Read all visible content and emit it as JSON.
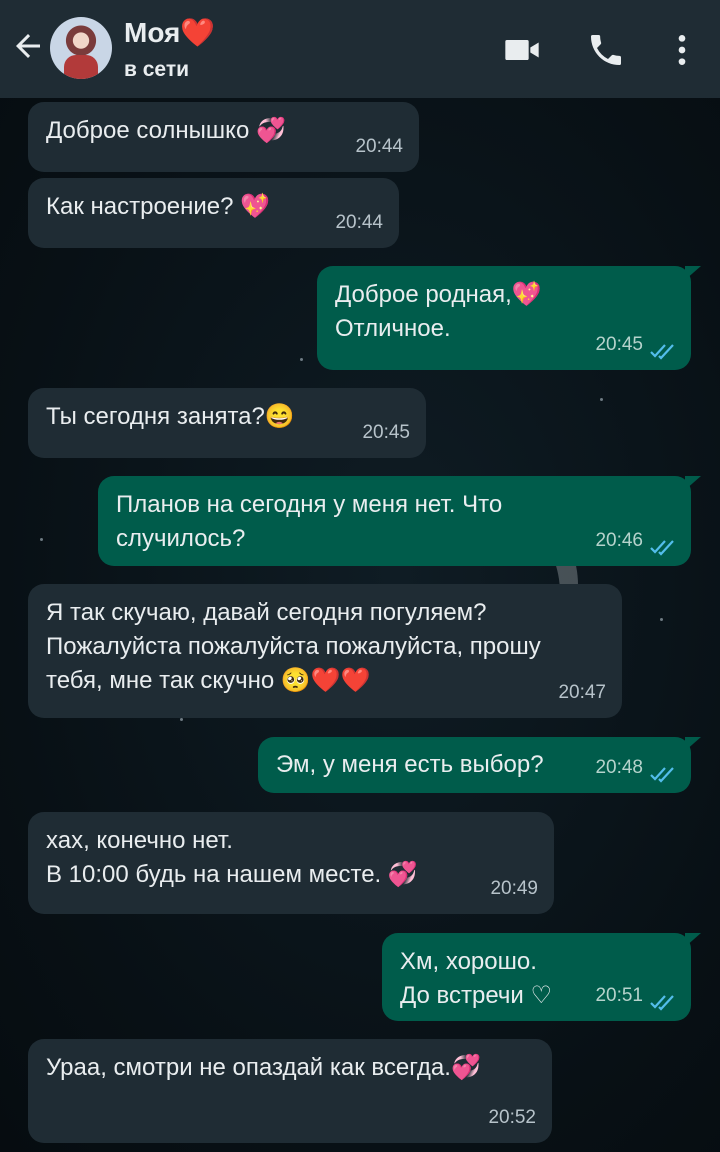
{
  "header": {
    "back_icon": "arrow-left-icon",
    "contact_name": "Моя",
    "contact_emoji": "❤️",
    "status": "в сети",
    "video_icon": "video-camera-icon",
    "call_icon": "phone-icon",
    "menu_icon": "more-vertical-icon"
  },
  "colors": {
    "header_bg": "#1f2c34",
    "incoming_bubble": "#1f2c34",
    "outgoing_bubble": "#005c4b",
    "read_ticks": "#53bdeb"
  },
  "messages": [
    {
      "direction": "in",
      "lines": [
        "Доброе солнышко 💞"
      ],
      "time": "20:44"
    },
    {
      "direction": "in",
      "lines": [
        "Как настроение? 💖"
      ],
      "time": "20:44"
    },
    {
      "direction": "out",
      "lines": [
        "Доброе родная,💖",
        "Отличное."
      ],
      "time": "20:45",
      "status": "read"
    },
    {
      "direction": "in",
      "lines": [
        "Ты сегодня занята?😄"
      ],
      "time": "20:45"
    },
    {
      "direction": "out",
      "lines": [
        "Планов на сегодня у меня нет. Что",
        "случилось?"
      ],
      "time": "20:46",
      "status": "read"
    },
    {
      "direction": "in",
      "lines": [
        "Я так скучаю, давай сегодня погуляем?",
        "Пожалуйста пожалуйста пожалуйста, прошу",
        "тебя, мне так скучно 🥺❤️❤️"
      ],
      "time": "20:47"
    },
    {
      "direction": "out",
      "lines": [
        "Эм, у меня есть выбор?"
      ],
      "time": "20:48",
      "status": "read"
    },
    {
      "direction": "in",
      "lines": [
        "хах, конечно нет.",
        "В 10:00 будь на нашем месте. 💞"
      ],
      "time": "20:49"
    },
    {
      "direction": "out",
      "lines": [
        "Хм, хорошо.",
        "До встречи ♡"
      ],
      "time": "20:51",
      "status": "read"
    },
    {
      "direction": "in",
      "lines": [
        "Ураа, смотри не опаздай как всегда.💞"
      ],
      "time": "20:52"
    }
  ]
}
